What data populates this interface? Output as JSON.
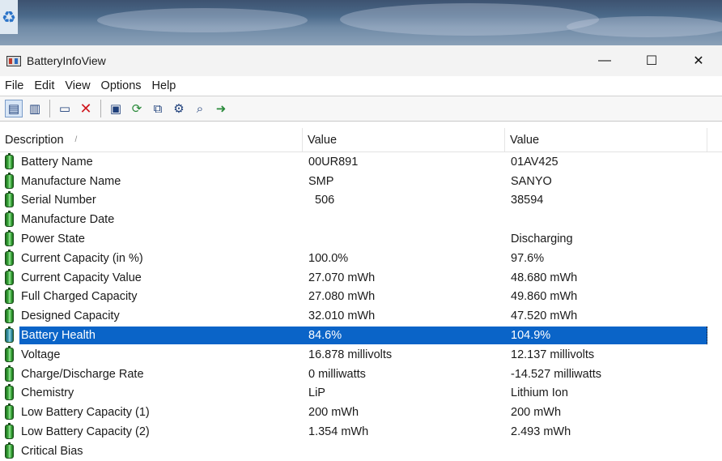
{
  "window": {
    "title": "BatteryInfoView",
    "minimize_glyph": "—",
    "maximize_glyph": "☐",
    "close_glyph": "✕"
  },
  "menu": [
    "File",
    "Edit",
    "View",
    "Options",
    "Help"
  ],
  "toolbar": {
    "icons": [
      "view-mode-icon",
      "battery-log-icon",
      "html-report-icon",
      "delete-icon",
      "save-icon",
      "refresh-icon",
      "copy-icon",
      "properties-icon",
      "find-icon",
      "exit-icon"
    ]
  },
  "columns": {
    "description": "Description",
    "value1": "Value",
    "value2": "Value",
    "sort_indicator": "/"
  },
  "rows": [
    {
      "label": "Battery Name",
      "v1": "00UR891",
      "v2": "01AV425"
    },
    {
      "label": "Manufacture Name",
      "v1": "SMP",
      "v2": "SANYO"
    },
    {
      "label": "Serial Number",
      "v1": "  506",
      "v2": "38594"
    },
    {
      "label": "Manufacture Date",
      "v1": "",
      "v2": ""
    },
    {
      "label": "Power State",
      "v1": "",
      "v2": "Discharging"
    },
    {
      "label": "Current Capacity (in %)",
      "v1": "100.0%",
      "v2": "97.6%"
    },
    {
      "label": "Current Capacity Value",
      "v1": "27.070 mWh",
      "v2": "48.680 mWh"
    },
    {
      "label": "Full Charged Capacity",
      "v1": "27.080 mWh",
      "v2": "49.860 mWh"
    },
    {
      "label": "Designed Capacity",
      "v1": "32.010 mWh",
      "v2": "47.520 mWh"
    },
    {
      "label": "Battery Health",
      "v1": "84.6%",
      "v2": "104.9%",
      "selected": true
    },
    {
      "label": "Voltage",
      "v1": "16.878 millivolts",
      "v2": "12.137 millivolts"
    },
    {
      "label": "Charge/Discharge Rate",
      "v1": "0 milliwatts",
      "v2": "-14.527 milliwatts"
    },
    {
      "label": "Chemistry",
      "v1": "LiP",
      "v2": "Lithium Ion"
    },
    {
      "label": "Low Battery Capacity (1)",
      "v1": "200 mWh",
      "v2": "200 mWh"
    },
    {
      "label": "Low Battery Capacity (2)",
      "v1": "1.354 mWh",
      "v2": "2.493 mWh"
    },
    {
      "label": "Critical Bias",
      "v1": "",
      "v2": ""
    }
  ],
  "colors": {
    "selection": "#0a64c8",
    "battery_green": "#3cae3c"
  }
}
